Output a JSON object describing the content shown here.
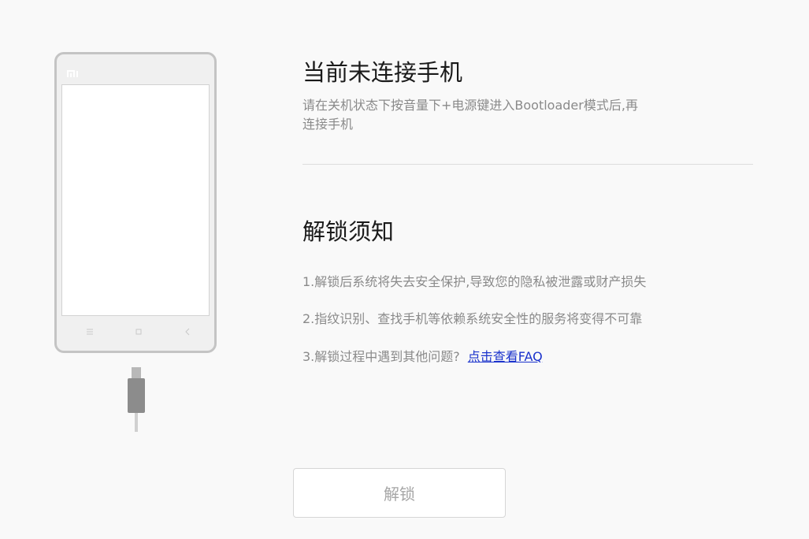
{
  "phone": {
    "logo_text": "mi",
    "nav_icons": [
      "menu-icon",
      "home-icon",
      "back-icon"
    ],
    "cable_icon": "usb-cable-icon"
  },
  "connection": {
    "title": "当前未连接手机",
    "subtitle_line1": "请在关机状态下按音量下+电源键进入Bootloader模式后,再",
    "subtitle_line2": "连接手机"
  },
  "notice": {
    "title": "解锁须知",
    "item1": "1.解锁后系统将失去安全保护,导致您的隐私被泄露或财产损失",
    "item2": "2.指纹识别、查找手机等依赖系统安全性的服务将变得不可靠",
    "item3_text": "3.解锁过程中遇到其他问题?",
    "item3_link": "点击查看FAQ"
  },
  "actions": {
    "unlock_label": "解锁"
  },
  "colors": {
    "background": "#f9f9f9",
    "link": "#1a32cc",
    "muted_text": "#8a8a8a",
    "title_text": "#1a1a1a"
  }
}
